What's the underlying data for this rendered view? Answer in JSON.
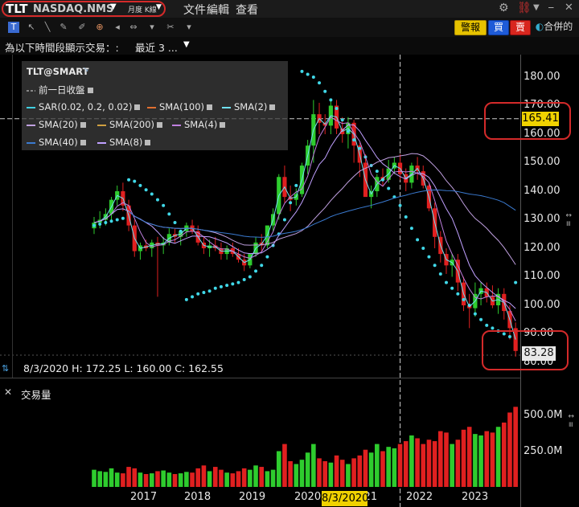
{
  "titlebar": {
    "symbol": "TLT",
    "exchange": "NASDAQ.NMS",
    "period": "月度 K線",
    "menu": [
      "文件",
      "編輯",
      "查看"
    ]
  },
  "toolbar": {
    "alert_label": "警報",
    "buy_label": "買",
    "sell_label": "賣",
    "merge_label": "合併的"
  },
  "timebar": {
    "label": "為以下時間段顯示交易：:",
    "value": "最近 3 ..."
  },
  "legend": {
    "title": "TLT@SMART",
    "items": [
      {
        "label": "前一日收盤",
        "color": "#888888"
      },
      {
        "label": "SAR(0.02, 0.2, 0.02)",
        "color": "#40d0e0"
      },
      {
        "label": "SMA(100)",
        "color": "#e07030"
      },
      {
        "label": "SMA(2)",
        "color": "#70e0f0"
      },
      {
        "label": "SMA(20)",
        "color": "#c0a0e0"
      },
      {
        "label": "SMA(200)",
        "color": "#d0a040"
      },
      {
        "label": "SMA(4)",
        "color": "#c080e0"
      },
      {
        "label": "SMA(40)",
        "color": "#3a7ad0"
      },
      {
        "label": "SMA(8)",
        "color": "#c0a0ff"
      }
    ]
  },
  "ohlc": "8/3/2020  H: 172.25  L: 160.00  C: 162.55",
  "volume_title": "交易量",
  "price_axis": [
    "180.00",
    "170.00",
    "160.00",
    "150.00",
    "140.00",
    "130.00",
    "120.00",
    "110.00",
    "100.00",
    "90.00",
    "80.00"
  ],
  "volume_axis": [
    "500.0M",
    "250.0M"
  ],
  "crosshair_price": "165.41",
  "last_price": "83.28",
  "crosshair_date": "8/3/2020",
  "colors": {
    "up": "#2ecc2e",
    "down": "#e02020",
    "sar": "#40d8e8",
    "alert": "#e6c200",
    "highlight": "#d42a2a"
  },
  "chart_data": {
    "type": "candlestick",
    "x_ticks": [
      "2017",
      "2018",
      "2019",
      "2020",
      "2021",
      "2022",
      "2023"
    ],
    "x_tick_years": [
      2017,
      2018,
      2019,
      2020,
      2021,
      2022,
      2023
    ],
    "start": "2016-03",
    "ylim": [
      78,
      185
    ],
    "candles": [
      [
        127,
        131,
        125,
        129
      ],
      [
        129,
        133,
        127,
        130
      ],
      [
        130,
        134,
        128,
        132
      ],
      [
        132,
        138,
        130,
        137
      ],
      [
        137,
        142,
        135,
        140
      ],
      [
        140,
        143,
        133,
        135
      ],
      [
        135,
        137,
        126,
        128
      ],
      [
        128,
        130,
        117,
        119
      ],
      [
        119,
        122,
        116,
        121
      ],
      [
        121,
        123,
        119,
        120
      ],
      [
        120,
        123,
        117,
        122
      ],
      [
        122,
        124,
        103,
        121
      ],
      [
        121,
        124,
        118,
        122
      ],
      [
        122,
        127,
        121,
        125
      ],
      [
        125,
        127,
        122,
        124
      ],
      [
        124,
        126,
        121,
        126
      ],
      [
        126,
        129,
        124,
        128
      ],
      [
        128,
        130,
        125,
        126
      ],
      [
        126,
        128,
        121,
        122
      ],
      [
        122,
        124,
        118,
        120
      ],
      [
        120,
        123,
        117,
        121
      ],
      [
        121,
        124,
        119,
        120
      ],
      [
        120,
        122,
        116,
        118
      ],
      [
        118,
        121,
        116,
        120
      ],
      [
        120,
        122,
        117,
        118
      ],
      [
        118,
        120,
        115,
        116
      ],
      [
        116,
        118,
        112,
        114
      ],
      [
        114,
        118,
        113,
        118
      ],
      [
        118,
        124,
        117,
        122
      ],
      [
        122,
        125,
        119,
        121
      ],
      [
        121,
        128,
        120,
        128
      ],
      [
        128,
        134,
        126,
        132
      ],
      [
        132,
        146,
        130,
        145
      ],
      [
        145,
        149,
        136,
        138
      ],
      [
        138,
        142,
        133,
        137
      ],
      [
        137,
        141,
        135,
        139
      ],
      [
        139,
        150,
        138,
        149
      ],
      [
        149,
        158,
        146,
        156
      ],
      [
        156,
        172,
        150,
        167
      ],
      [
        167,
        171,
        160,
        164
      ],
      [
        164,
        167,
        160,
        163
      ],
      [
        163,
        172,
        160,
        170
      ],
      [
        170,
        172,
        160,
        162
      ],
      [
        162,
        166,
        157,
        160
      ],
      [
        160,
        166,
        155,
        164
      ],
      [
        164,
        165,
        150,
        156
      ],
      [
        156,
        157,
        145,
        150
      ],
      [
        150,
        153,
        139,
        138
      ],
      [
        138,
        142,
        134,
        140
      ],
      [
        140,
        146,
        138,
        145
      ],
      [
        145,
        148,
        142,
        144
      ],
      [
        144,
        151,
        143,
        148
      ],
      [
        148,
        152,
        146,
        150
      ],
      [
        150,
        153,
        144,
        146
      ],
      [
        146,
        148,
        140,
        143
      ],
      [
        143,
        150,
        141,
        149
      ],
      [
        149,
        152,
        144,
        147
      ],
      [
        147,
        149,
        141,
        142
      ],
      [
        142,
        143,
        133,
        134
      ],
      [
        134,
        136,
        120,
        124
      ],
      [
        124,
        126,
        115,
        118
      ],
      [
        118,
        120,
        111,
        114
      ],
      [
        114,
        118,
        110,
        116
      ],
      [
        116,
        118,
        105,
        108
      ],
      [
        108,
        110,
        98,
        100
      ],
      [
        100,
        104,
        92,
        99
      ],
      [
        99,
        108,
        96,
        104
      ],
      [
        104,
        108,
        100,
        106
      ],
      [
        106,
        108,
        101,
        103
      ],
      [
        103,
        107,
        99,
        100
      ],
      [
        100,
        106,
        97,
        104
      ],
      [
        104,
        106,
        95,
        98
      ],
      [
        98,
        100,
        88,
        92
      ],
      [
        92,
        94,
        82,
        84
      ]
    ],
    "sar": [
      128,
      128.5,
      129,
      129.5,
      130,
      130.5,
      144,
      143.5,
      142,
      140.5,
      139,
      137,
      135,
      132,
      129,
      126,
      102,
      103,
      104,
      104.5,
      105,
      106,
      106.5,
      107,
      107.5,
      108,
      109,
      110,
      112,
      114,
      117,
      121,
      125,
      130,
      136,
      142,
      182,
      181,
      180,
      178,
      175,
      172,
      169,
      165,
      161,
      158,
      155,
      152,
      149,
      147,
      144,
      141,
      138,
      135,
      131,
      127,
      123,
      120,
      117,
      114,
      111,
      108,
      106,
      104,
      102,
      100,
      97,
      95,
      93,
      92,
      91,
      90,
      89,
      108
    ],
    "volume_m": [
      120,
      110,
      105,
      130,
      100,
      95,
      140,
      130,
      100,
      90,
      95,
      110,
      115,
      100,
      90,
      95,
      105,
      100,
      130,
      150,
      110,
      140,
      120,
      100,
      95,
      110,
      130,
      120,
      150,
      140,
      110,
      120,
      250,
      300,
      180,
      160,
      190,
      240,
      300,
      200,
      180,
      170,
      220,
      190,
      160,
      200,
      220,
      260,
      240,
      300,
      250,
      280,
      270,
      300,
      320,
      360,
      340,
      300,
      330,
      320,
      390,
      380,
      300,
      330,
      400,
      420,
      370,
      360,
      390,
      380,
      420,
      450,
      520,
      560
    ]
  }
}
